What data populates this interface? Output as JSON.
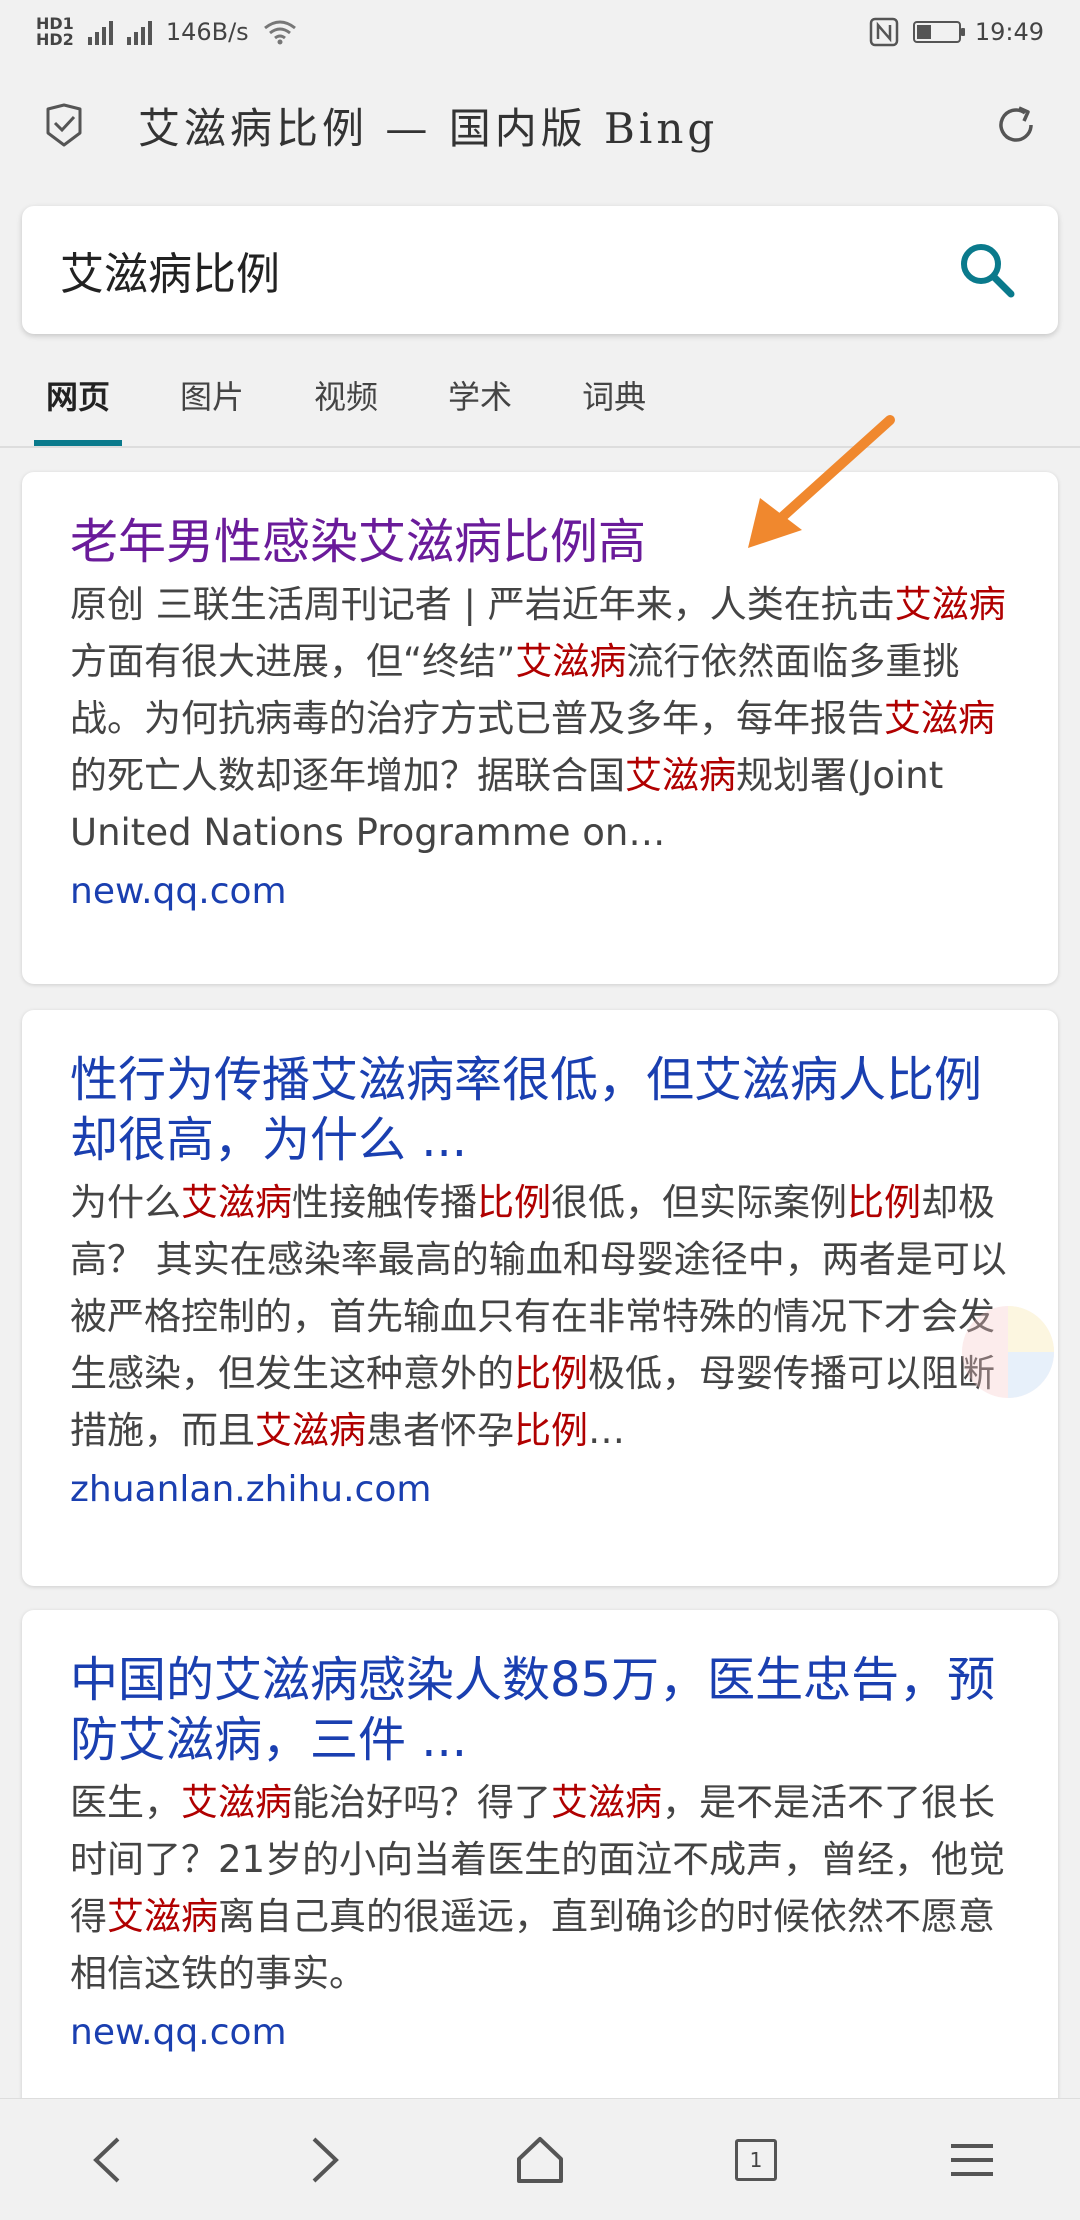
{
  "status_bar": {
    "net_label_1": "HD1",
    "net_label_2": "HD2",
    "network_speed": "146B/s",
    "time": "19:49",
    "icons": [
      "signal-icon",
      "wifi-icon",
      "nfc-icon",
      "battery-icon"
    ]
  },
  "header": {
    "title": "艾滋病比例 — 国内版 Bing",
    "left_icon": "shield-check-icon",
    "right_icon": "refresh-icon"
  },
  "search": {
    "query": "艾滋病比例",
    "icon": "search-icon",
    "accent_color": "#0a7a8c"
  },
  "tabs": [
    {
      "label": "网页",
      "active": true
    },
    {
      "label": "图片",
      "active": false
    },
    {
      "label": "视频",
      "active": false
    },
    {
      "label": "学术",
      "active": false
    },
    {
      "label": "词典",
      "active": false
    }
  ],
  "results": [
    {
      "title": "老年男性感染艾滋病比例高",
      "snippet_parts": [
        {
          "t": "原创 三联生活周刊记者 | 严岩近年来，人类在抗击",
          "h": false
        },
        {
          "t": "艾滋病",
          "h": true
        },
        {
          "t": "方面有很大进展，但“终结”",
          "h": false
        },
        {
          "t": "艾滋病",
          "h": true
        },
        {
          "t": "流行依然面临多重挑战。为何抗病毒的治疗方式已普及多年，每年报告",
          "h": false
        },
        {
          "t": "艾滋病",
          "h": true
        },
        {
          "t": "的死亡人数却逐年增加？据联合国",
          "h": false
        },
        {
          "t": "艾滋病",
          "h": true
        },
        {
          "t": "规划署(Joint United Nations Programme on…",
          "h": false
        }
      ],
      "url": "new.qq.com",
      "visited": true
    },
    {
      "title": "性行为传播艾滋病率很低，但艾滋病人比例却很高，为什么 ...",
      "snippet_parts": [
        {
          "t": "为什么",
          "h": false
        },
        {
          "t": "艾滋病",
          "h": true
        },
        {
          "t": "性接触传播",
          "h": false
        },
        {
          "t": "比例",
          "h": true
        },
        {
          "t": "很低，但实际案例",
          "h": false
        },
        {
          "t": "比例",
          "h": true
        },
        {
          "t": "却极高？ 其实在感染率最高的输血和母婴途径中，两者是可以被严格控制的，首先输血只有在非常特殊的情况下才会发生感染，但发生这种意外的",
          "h": false
        },
        {
          "t": "比例",
          "h": true
        },
        {
          "t": "极低，母婴传播可以阻断措施，而且",
          "h": false
        },
        {
          "t": "艾滋病",
          "h": true
        },
        {
          "t": "患者怀孕",
          "h": false
        },
        {
          "t": "比例",
          "h": true
        },
        {
          "t": "…",
          "h": false
        }
      ],
      "url": "zhuanlan.zhihu.com",
      "visited": false
    },
    {
      "title": "中国的艾滋病感染人数85万，医生忠告，预防艾滋病，三件 ...",
      "snippet_parts": [
        {
          "t": "医生，",
          "h": false
        },
        {
          "t": "艾滋病",
          "h": true
        },
        {
          "t": "能治好吗？得了",
          "h": false
        },
        {
          "t": "艾滋病",
          "h": true
        },
        {
          "t": "，是不是活不了很长时间了？21岁的小向当着医生的面泣不成声，曾经，他觉得",
          "h": false
        },
        {
          "t": "艾滋病",
          "h": true
        },
        {
          "t": "离自己真的很遥远，直到确诊的时候依然不愿意相信这铁的事实。",
          "h": false
        }
      ],
      "url": "new.qq.com",
      "visited": false
    }
  ],
  "bottom_nav": {
    "items": [
      "back-icon",
      "forward-icon",
      "home-icon",
      "tabs-icon",
      "menu-icon"
    ],
    "tab_count": "1"
  },
  "colors": {
    "link": "#1a3fb0",
    "visited_link": "#6a1b9a",
    "highlight": "#b00000",
    "annotation_arrow": "#f0882e"
  }
}
